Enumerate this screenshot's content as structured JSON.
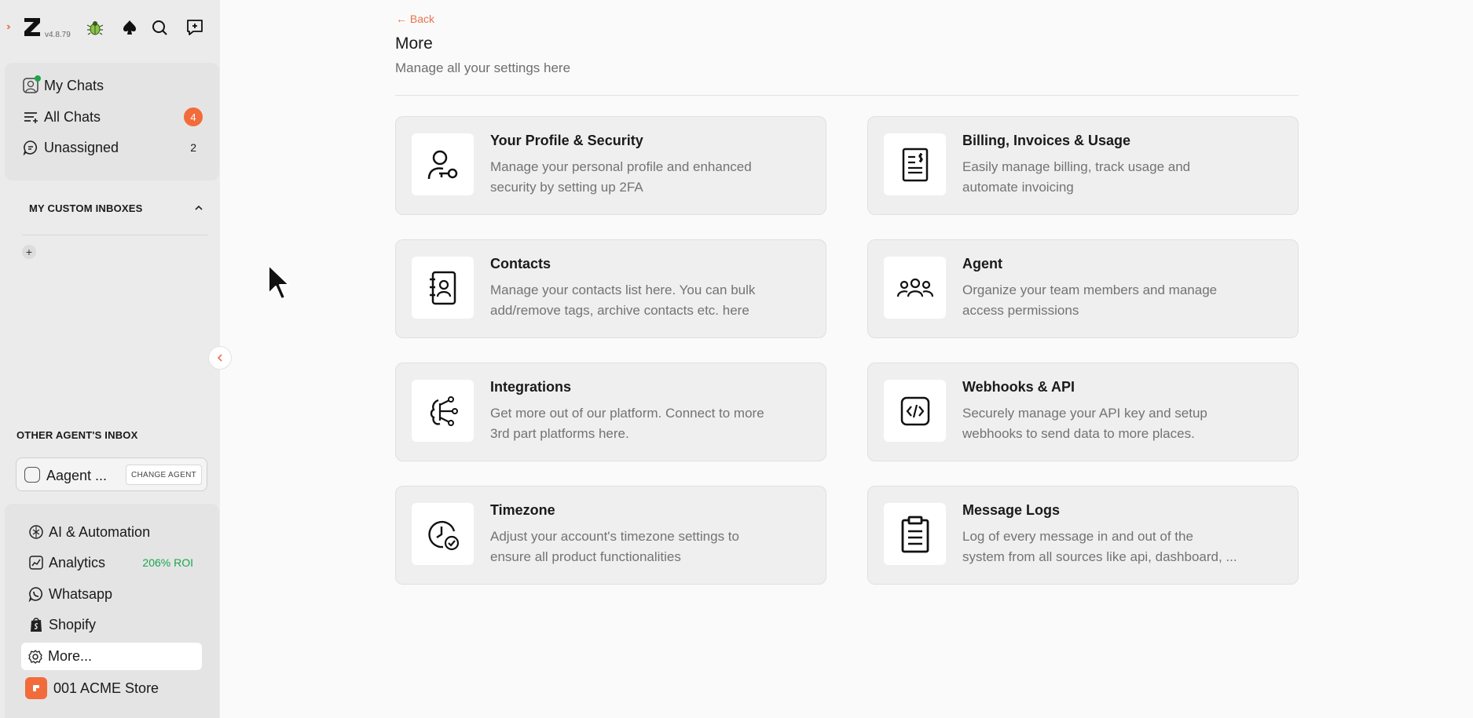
{
  "app": {
    "version": "v4.8.79"
  },
  "sidebar": {
    "chats": [
      {
        "label": "My Chats",
        "icon": "avatar-icon"
      },
      {
        "label": "All Chats",
        "icon": "filter-list-icon",
        "badge": "4",
        "badge_color": "#f26b3a"
      },
      {
        "label": "Unassigned",
        "icon": "chat-bubble-icon",
        "count": "2"
      }
    ],
    "custom_inboxes_title": "MY CUSTOM INBOXES",
    "other_agents_title": "OTHER AGENT'S INBOX",
    "agent_name": "Aagent ...",
    "change_agent_label": "CHANGE AGENT",
    "bottom_nav": [
      {
        "label": "AI & Automation",
        "icon": "ai-icon"
      },
      {
        "label": "Analytics",
        "icon": "chart-icon",
        "extra": "206% ROI",
        "extra_color": "#1aa64a"
      },
      {
        "label": "Whatsapp",
        "icon": "whatsapp-icon"
      },
      {
        "label": "Shopify",
        "icon": "shopify-icon"
      },
      {
        "label": "More...",
        "icon": "gear-icon",
        "active": true
      },
      {
        "label": "001 ACME Store",
        "icon": "store-icon"
      }
    ]
  },
  "main": {
    "back_label": "← Back",
    "title": "More",
    "subtitle": "Manage all your settings here",
    "cards": [
      {
        "title": "Your Profile & Security",
        "desc": "Manage your personal profile and enhanced\nsecurity by setting up 2FA",
        "icon": "user-key-icon"
      },
      {
        "title": "Billing, Invoices & Usage",
        "desc": "Easily manage billing, track usage and\nautomate invoicing",
        "icon": "invoice-icon"
      },
      {
        "title": "Contacts",
        "desc": "Manage your contacts list here. You can bulk\nadd/remove tags, archive contacts etc. here",
        "icon": "contact-book-icon"
      },
      {
        "title": "Agent",
        "desc": "Organize your team members and manage\naccess permissions",
        "icon": "team-icon"
      },
      {
        "title": "Integrations",
        "desc": "Get more out of our platform. Connect to more\n3rd part platforms here.",
        "icon": "integrations-icon"
      },
      {
        "title": "Webhooks & API",
        "desc": "Securely manage your API key and setup\nwebhooks to send data to more places.",
        "icon": "code-icon"
      },
      {
        "title": "Timezone",
        "desc": "Adjust your account's timezone settings to\nensure all product functionalities",
        "icon": "clock-check-icon"
      },
      {
        "title": "Message Logs",
        "desc": "Log of every message in and out of the\nsystem from all sources like api, dashboard, ...",
        "icon": "clipboard-icon"
      }
    ]
  }
}
